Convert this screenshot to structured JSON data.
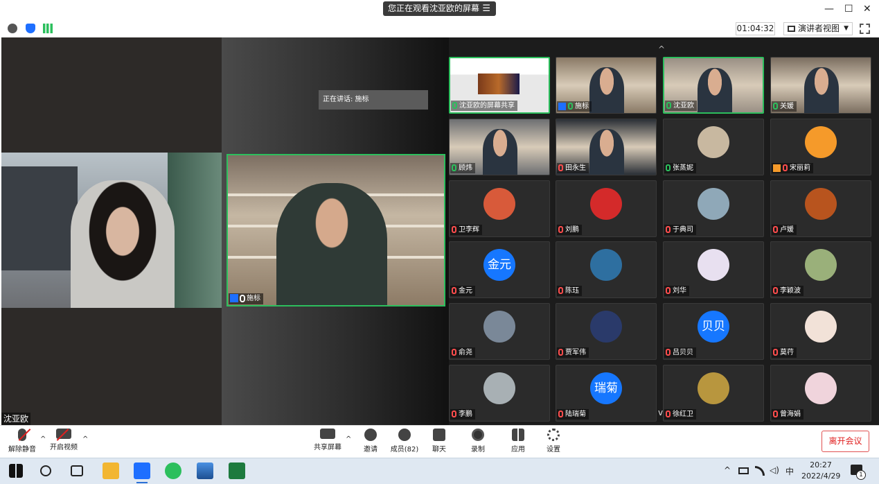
{
  "titlebar": {
    "viewing_text": "您正在观看沈亚欧的屏幕",
    "menu_glyph": "☰",
    "minimize": "—",
    "maximize": "☐",
    "close": "✕"
  },
  "toolbar": {
    "timer": "01:04:32",
    "view_mode": "演讲者视图",
    "icons": [
      "info-icon",
      "shield-icon",
      "signal-icon",
      "fullscreen-icon"
    ]
  },
  "share": {
    "speaking_label": "正在讲话: 施标",
    "main_video_name": "施标",
    "sharer_name": "沈亚欧"
  },
  "gallery": {
    "tiles": [
      {
        "name": "沈亚欧的屏幕共享",
        "kind": "screen",
        "muted": false,
        "active": true,
        "icon_color": "#2cbf5d"
      },
      {
        "name": "施标",
        "kind": "video",
        "muted": false,
        "active": false,
        "avatar_badge": true,
        "bg": "#8a7a66"
      },
      {
        "name": "沈亚欧",
        "kind": "video",
        "muted": false,
        "active": true,
        "bg": "#9a9085"
      },
      {
        "name": "关媛",
        "kind": "video",
        "muted": false,
        "active": false,
        "bg": "#7b6e60"
      },
      {
        "name": "顾炜",
        "kind": "video",
        "muted": false,
        "active": false,
        "bg": "#6d6f72"
      },
      {
        "name": "田永生",
        "kind": "video",
        "muted": true,
        "active": false,
        "bg": "#2a2f36"
      },
      {
        "name": "张蒸妮",
        "kind": "avatar",
        "muted": false,
        "active": false,
        "avatar_color": "#c8b8a0",
        "avatar_text": ""
      },
      {
        "name": "宋丽莉",
        "kind": "avatar",
        "muted": true,
        "active": false,
        "avatar_color": "#f59a2a",
        "avatar_text": "",
        "avatar_badge": true
      },
      {
        "name": "卫李辉",
        "kind": "avatar",
        "muted": true,
        "active": false,
        "avatar_color": "#d85a3a",
        "avatar_text": ""
      },
      {
        "name": "刘鹏",
        "kind": "avatar",
        "muted": true,
        "active": false,
        "avatar_color": "#d42a2a",
        "avatar_text": ""
      },
      {
        "name": "于典司",
        "kind": "avatar",
        "muted": true,
        "active": false,
        "avatar_color": "#8fa8b8",
        "avatar_text": ""
      },
      {
        "name": "卢媛",
        "kind": "avatar",
        "muted": true,
        "active": false,
        "avatar_color": "#b8541e",
        "avatar_text": ""
      },
      {
        "name": "金元",
        "kind": "avatar",
        "muted": true,
        "active": false,
        "avatar_color": "#1677ff",
        "avatar_text": "金元"
      },
      {
        "name": "陈珏",
        "kind": "avatar",
        "muted": true,
        "active": false,
        "avatar_color": "#2e6fa0",
        "avatar_text": ""
      },
      {
        "name": "刘华",
        "kind": "avatar",
        "muted": true,
        "active": false,
        "avatar_color": "#e8e0f0",
        "avatar_text": ""
      },
      {
        "name": "李颖波",
        "kind": "avatar",
        "muted": true,
        "active": false,
        "avatar_color": "#9ab07a",
        "avatar_text": ""
      },
      {
        "name": "俞尧",
        "kind": "avatar",
        "muted": true,
        "active": false,
        "avatar_color": "#7a8898",
        "avatar_text": ""
      },
      {
        "name": "贾军伟",
        "kind": "avatar",
        "muted": true,
        "active": false,
        "avatar_color": "#2a3a6a",
        "avatar_text": ""
      },
      {
        "name": "吕贝贝",
        "kind": "avatar",
        "muted": true,
        "active": false,
        "avatar_color": "#1677ff",
        "avatar_text": "贝贝"
      },
      {
        "name": "莫荇",
        "kind": "avatar",
        "muted": true,
        "active": false,
        "avatar_color": "#f2e2d8",
        "avatar_text": ""
      },
      {
        "name": "李鹏",
        "kind": "avatar",
        "muted": true,
        "active": false,
        "avatar_color": "#a8b0b4",
        "avatar_text": ""
      },
      {
        "name": "陆瑞菊",
        "kind": "avatar",
        "muted": true,
        "active": false,
        "avatar_color": "#1677ff",
        "avatar_text": "瑞菊"
      },
      {
        "name": "徐红卫",
        "kind": "avatar",
        "muted": true,
        "active": false,
        "avatar_color": "#b8963e",
        "avatar_text": ""
      },
      {
        "name": "曾海娟",
        "kind": "avatar",
        "muted": true,
        "active": false,
        "avatar_color": "#f0d4dc",
        "avatar_text": ""
      }
    ],
    "scroll_up": "^",
    "scroll_down": "v"
  },
  "bottombar": {
    "unmute": "解除静音",
    "start_video": "开启视频",
    "share_screen": "共享屏幕",
    "invite": "邀请",
    "members": "成员(82)",
    "chat": "聊天",
    "record": "录制",
    "apps": "应用",
    "settings": "设置",
    "leave": "离开会议"
  },
  "taskbar": {
    "tray_ime": "中",
    "time": "20:27",
    "date": "2022/4/29",
    "notifications": "1"
  }
}
